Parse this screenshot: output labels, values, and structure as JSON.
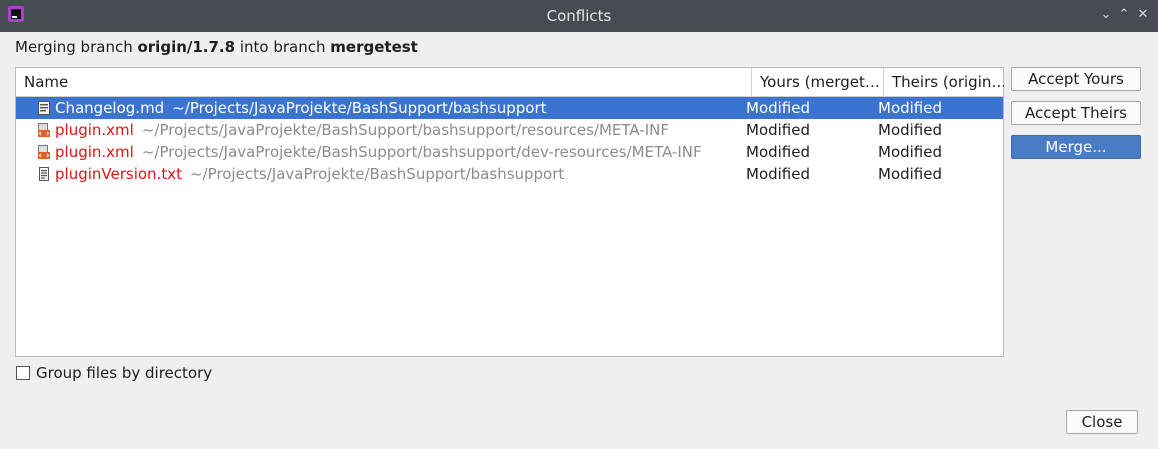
{
  "window": {
    "title": "Conflicts"
  },
  "merge_info": {
    "prefix": "Merging branch",
    "source_branch": "origin/1.7.8",
    "middle": "into branch",
    "target_branch": "mergetest"
  },
  "table": {
    "columns": [
      "Name",
      "Yours (merget…",
      "Theirs (origin…"
    ],
    "rows": [
      {
        "name": "Changelog.md",
        "path": "~/Projects/JavaProjekte/BashSupport/bashsupport",
        "yours": "Modified",
        "theirs": "Modified",
        "icon": "markdown-file-icon",
        "selected": true
      },
      {
        "name": "plugin.xml",
        "path": "~/Projects/JavaProjekte/BashSupport/bashsupport/resources/META-INF",
        "yours": "Modified",
        "theirs": "Modified",
        "icon": "xml-file-icon",
        "selected": false
      },
      {
        "name": "plugin.xml",
        "path": "~/Projects/JavaProjekte/BashSupport/bashsupport/dev-resources/META-INF",
        "yours": "Modified",
        "theirs": "Modified",
        "icon": "xml-file-icon",
        "selected": false
      },
      {
        "name": "pluginVersion.txt",
        "path": "~/Projects/JavaProjekte/BashSupport/bashsupport",
        "yours": "Modified",
        "theirs": "Modified",
        "icon": "text-file-icon",
        "selected": false
      }
    ]
  },
  "buttons": {
    "accept_yours": "Accept Yours",
    "accept_theirs": "Accept Theirs",
    "merge": "Merge...",
    "close": "Close"
  },
  "options": {
    "group_by_directory_label": "Group files by directory",
    "group_by_directory_checked": false
  },
  "colors": {
    "selection": "#3a74d0",
    "conflict_name": "#e01414",
    "path": "#8c8c8c",
    "titlebar": "#474b52"
  }
}
